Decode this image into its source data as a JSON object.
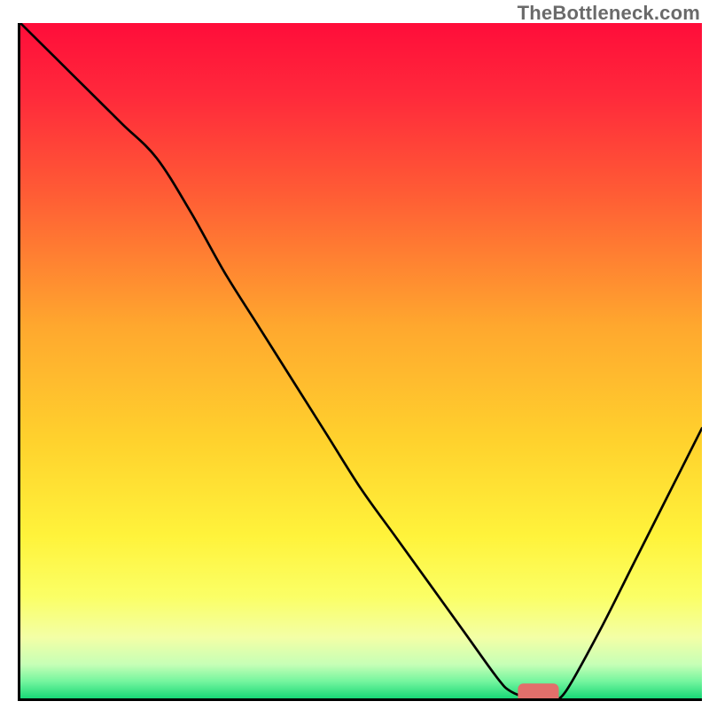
{
  "watermark": "TheBottleneck.com",
  "chart_data": {
    "type": "line",
    "title": "",
    "xlabel": "",
    "ylabel": "",
    "xlim": [
      0,
      100
    ],
    "ylim": [
      0,
      100
    ],
    "grid": false,
    "legend": false,
    "series": [
      {
        "name": "bottleneck-curve",
        "x": [
          0,
          5,
          10,
          15,
          20,
          25,
          30,
          35,
          40,
          45,
          50,
          55,
          60,
          65,
          70,
          72,
          75,
          78,
          80,
          85,
          90,
          95,
          100
        ],
        "values": [
          100,
          95,
          90,
          85,
          80,
          72,
          63,
          55,
          47,
          39,
          31,
          24,
          17,
          10,
          3,
          1,
          0,
          0,
          1,
          10,
          20,
          30,
          40
        ]
      }
    ],
    "marker": {
      "x_center": 76,
      "y": 0.6,
      "width": 6,
      "color": "#e26f6b",
      "radius": 1.6
    },
    "background_gradient": {
      "stops": [
        {
          "offset": 0.0,
          "color": "#ff0d3a"
        },
        {
          "offset": 0.11,
          "color": "#ff2a3b"
        },
        {
          "offset": 0.25,
          "color": "#ff5b35"
        },
        {
          "offset": 0.45,
          "color": "#ffa82e"
        },
        {
          "offset": 0.62,
          "color": "#ffd22d"
        },
        {
          "offset": 0.76,
          "color": "#fff33b"
        },
        {
          "offset": 0.85,
          "color": "#fbff66"
        },
        {
          "offset": 0.91,
          "color": "#f3ffa6"
        },
        {
          "offset": 0.95,
          "color": "#c6ffb6"
        },
        {
          "offset": 0.975,
          "color": "#74f59e"
        },
        {
          "offset": 1.0,
          "color": "#18d877"
        }
      ]
    }
  }
}
